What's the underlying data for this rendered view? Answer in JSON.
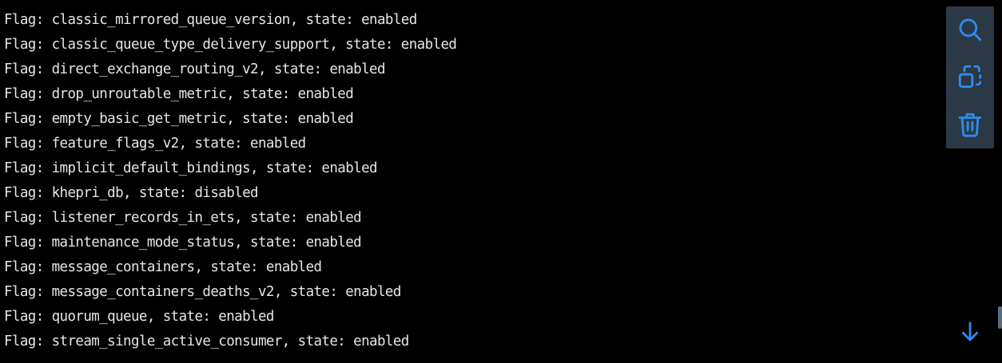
{
  "terminal": {
    "lines": [
      "Flag: classic_mirrored_queue_version, state: enabled",
      "Flag: classic_queue_type_delivery_support, state: enabled",
      "Flag: direct_exchange_routing_v2, state: enabled",
      "Flag: drop_unroutable_metric, state: enabled",
      "Flag: empty_basic_get_metric, state: enabled",
      "Flag: feature_flags_v2, state: enabled",
      "Flag: implicit_default_bindings, state: enabled",
      "Flag: khepri_db, state: disabled",
      "Flag: listener_records_in_ets, state: enabled",
      "Flag: maintenance_mode_status, state: enabled",
      "Flag: message_containers, state: enabled",
      "Flag: message_containers_deaths_v2, state: enabled",
      "Flag: quorum_queue, state: enabled",
      "Flag: stream_single_active_consumer, state: enabled"
    ]
  },
  "toolbar": {
    "buttons": [
      {
        "icon": "search-icon"
      },
      {
        "icon": "copy-icon"
      },
      {
        "icon": "trash-icon"
      }
    ]
  },
  "scroll": {
    "icon": "arrow-down-icon"
  },
  "colors": {
    "background": "#000000",
    "text": "#e6e6e6",
    "toolbar_bg": "#2b3946",
    "accent": "#2d8cf0"
  }
}
